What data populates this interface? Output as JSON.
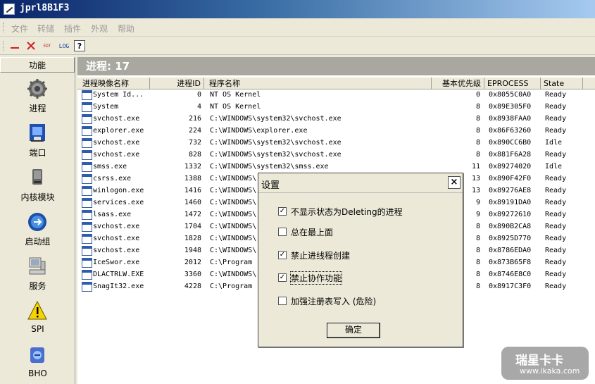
{
  "window": {
    "title": "jprl8B1F3"
  },
  "menu": [
    "文件",
    "转储",
    "插件",
    "外观",
    "帮助"
  ],
  "toolbar": {
    "edt_label": "EDT",
    "log_label": "LOG",
    "help_label": "?"
  },
  "sidebar": {
    "header": "功能",
    "items": [
      {
        "label": "进程",
        "icon": "gear-icon"
      },
      {
        "label": "端口",
        "icon": "network-icon"
      },
      {
        "label": "内核模块",
        "icon": "disk-icon"
      },
      {
        "label": "启动组",
        "icon": "startup-icon"
      },
      {
        "label": "服务",
        "icon": "computer-icon"
      },
      {
        "label": "SPI",
        "icon": "warning-icon"
      },
      {
        "label": "BHO",
        "icon": "bho-icon"
      }
    ]
  },
  "main": {
    "header": "进程: 17",
    "columns": [
      "进程映像名称",
      "进程ID",
      "程序名称",
      "基本优先级",
      "EPROCESS",
      "State"
    ],
    "rows": [
      {
        "name": "System Id...",
        "pid": "0",
        "path": "NT OS Kernel",
        "prio": "0",
        "eproc": "0x8055C0A0",
        "state": "Ready"
      },
      {
        "name": "System",
        "pid": "4",
        "path": "NT OS Kernel",
        "prio": "8",
        "eproc": "0x89E305F0",
        "state": "Ready"
      },
      {
        "name": "svchost.exe",
        "pid": "216",
        "path": "C:\\WINDOWS\\system32\\svchost.exe",
        "prio": "8",
        "eproc": "0x8938FAA0",
        "state": "Ready"
      },
      {
        "name": "explorer.exe",
        "pid": "224",
        "path": "C:\\WINDOWS\\explorer.exe",
        "prio": "8",
        "eproc": "0x86F63260",
        "state": "Ready"
      },
      {
        "name": "svchost.exe",
        "pid": "732",
        "path": "C:\\WINDOWS\\system32\\svchost.exe",
        "prio": "8",
        "eproc": "0x890CC6B0",
        "state": "Idle"
      },
      {
        "name": "svchost.exe",
        "pid": "828",
        "path": "C:\\WINDOWS\\system32\\svchost.exe",
        "prio": "8",
        "eproc": "0x881F6A28",
        "state": "Ready"
      },
      {
        "name": "smss.exe",
        "pid": "1332",
        "path": "C:\\WINDOWS\\system32\\smss.exe",
        "prio": "11",
        "eproc": "0x89274020",
        "state": "Idle"
      },
      {
        "name": "csrss.exe",
        "pid": "1388",
        "path": "C:\\WINDOWS\\",
        "prio": "13",
        "eproc": "0x890F42F0",
        "state": "Ready"
      },
      {
        "name": "winlogon.exe",
        "pid": "1416",
        "path": "C:\\WINDOWS\\",
        "prio": "13",
        "eproc": "0x89276AE8",
        "state": "Ready"
      },
      {
        "name": "services.exe",
        "pid": "1460",
        "path": "C:\\WINDOWS\\",
        "prio": "9",
        "eproc": "0x89191DA0",
        "state": "Ready"
      },
      {
        "name": "lsass.exe",
        "pid": "1472",
        "path": "C:\\WINDOWS\\",
        "prio": "9",
        "eproc": "0x89272610",
        "state": "Ready"
      },
      {
        "name": "svchost.exe",
        "pid": "1704",
        "path": "C:\\WINDOWS\\",
        "prio": "8",
        "eproc": "0x890B2CA8",
        "state": "Ready"
      },
      {
        "name": "svchost.exe",
        "pid": "1828",
        "path": "C:\\WINDOWS\\",
        "prio": "8",
        "eproc": "0x8925D770",
        "state": "Ready"
      },
      {
        "name": "svchost.exe",
        "pid": "1948",
        "path": "C:\\WINDOWS\\",
        "prio": "8",
        "eproc": "0x8786EDA0",
        "state": "Ready"
      },
      {
        "name": "IceSwor.exe",
        "pid": "2012",
        "path": "C:\\Program",
        "prio": "8",
        "eproc": "0x873B65F8",
        "state": "Ready"
      },
      {
        "name": "DLACTRLW.EXE",
        "pid": "3360",
        "path": "C:\\WINDOWS\\",
        "prio": "8",
        "eproc": "0x8746E8C0",
        "state": "Ready"
      },
      {
        "name": "SnagIt32.exe",
        "pid": "4228",
        "path": "C:\\Program",
        "prio": "8",
        "eproc": "0x8917C3F0",
        "state": "Ready"
      }
    ]
  },
  "dialog": {
    "title": "设置",
    "close": "×",
    "options": [
      {
        "label": "不显示状态为Deleting的进程",
        "checked": true
      },
      {
        "label": "总在最上面",
        "checked": false
      },
      {
        "label": "禁止进线程创建",
        "checked": true
      },
      {
        "label": "禁止协作功能",
        "checked": true
      },
      {
        "label": "加强注册表写入 (危险)",
        "checked": false
      }
    ],
    "ok": "确定"
  },
  "watermark": {
    "line1": "瑞星卡卡",
    "line2": "www.ikaka.com"
  }
}
